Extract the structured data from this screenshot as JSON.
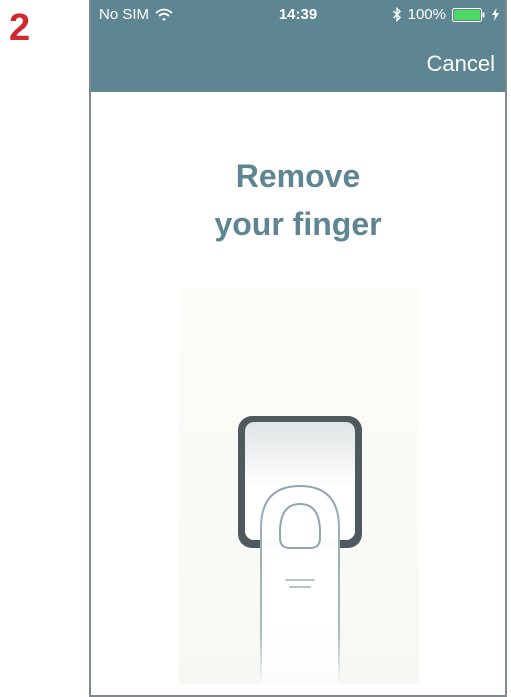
{
  "step_number": "2",
  "status_bar": {
    "carrier": "No SIM",
    "time": "14:39",
    "battery_percent": "100%",
    "wifi_icon": "wifi-icon",
    "bluetooth_icon": "bluetooth-icon",
    "battery_icon": "battery-icon",
    "charging_icon": "charging-bolt-icon"
  },
  "nav": {
    "cancel_label": "Cancel"
  },
  "main": {
    "title_line1": "Remove",
    "title_line2": "your finger",
    "illustration_icon": "fingerprint-sensor-finger-icon"
  },
  "colors": {
    "step_number": "#d0282e",
    "nav_background": "#5e8592",
    "title": "#5e8592",
    "battery_fill": "#4cd964"
  }
}
